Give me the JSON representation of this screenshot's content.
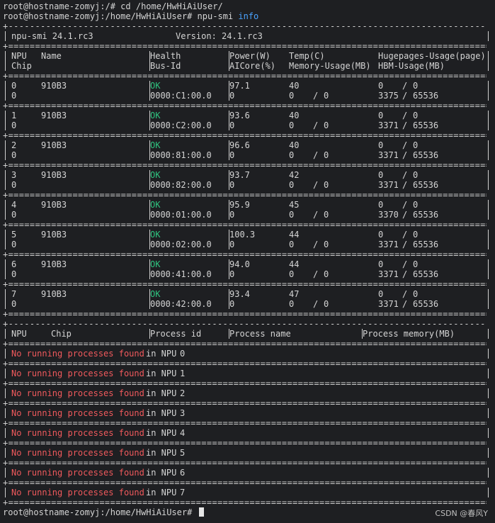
{
  "terminal": {
    "prompt1": "root@hostname-zomyj:/# ",
    "cmd1": "cd /home/HwHiAiUser/",
    "prompt2": "root@hostname-zomyj:/home/HwHiAiUser# ",
    "cmd2_base": "npu-smi ",
    "cmd2_keyword": "info",
    "prompt3": "root@hostname-zomyj:/home/HwHiAiUser# "
  },
  "smi": {
    "title_left": "npu-smi 24.1.rc3",
    "title_version": "Version: 24.1.rc3",
    "headers": {
      "npu": "NPU",
      "name": "Name",
      "health": "Health",
      "power": "Power(W)",
      "temp": "Temp(C)",
      "hugepages": "Hugepages-Usage(page)",
      "chip": "Chip",
      "busid": "Bus-Id",
      "aicore": "AICore(%)",
      "memory": "Memory-Usage(MB)",
      "hbm": "HBM-Usage(MB)"
    },
    "npus": [
      {
        "npu": "0",
        "name": "910B3",
        "health": "OK",
        "power": "97.1",
        "temp": "40",
        "huge_used": "0",
        "huge_total": "0",
        "chip": "0",
        "busid": "0000:C1:00.0",
        "aicore": "0",
        "mem_used": "0",
        "mem_total": "0",
        "hbm_used": "3375",
        "hbm_total": "65536"
      },
      {
        "npu": "1",
        "name": "910B3",
        "health": "OK",
        "power": "93.6",
        "temp": "40",
        "huge_used": "0",
        "huge_total": "0",
        "chip": "0",
        "busid": "0000:C2:00.0",
        "aicore": "0",
        "mem_used": "0",
        "mem_total": "0",
        "hbm_used": "3371",
        "hbm_total": "65536"
      },
      {
        "npu": "2",
        "name": "910B3",
        "health": "OK",
        "power": "96.6",
        "temp": "40",
        "huge_used": "0",
        "huge_total": "0",
        "chip": "0",
        "busid": "0000:81:00.0",
        "aicore": "0",
        "mem_used": "0",
        "mem_total": "0",
        "hbm_used": "3371",
        "hbm_total": "65536"
      },
      {
        "npu": "3",
        "name": "910B3",
        "health": "OK",
        "power": "93.7",
        "temp": "42",
        "huge_used": "0",
        "huge_total": "0",
        "chip": "0",
        "busid": "0000:82:00.0",
        "aicore": "0",
        "mem_used": "0",
        "mem_total": "0",
        "hbm_used": "3371",
        "hbm_total": "65536"
      },
      {
        "npu": "4",
        "name": "910B3",
        "health": "OK",
        "power": "95.9",
        "temp": "45",
        "huge_used": "0",
        "huge_total": "0",
        "chip": "0",
        "busid": "0000:01:00.0",
        "aicore": "0",
        "mem_used": "0",
        "mem_total": "0",
        "hbm_used": "3370",
        "hbm_total": "65536"
      },
      {
        "npu": "5",
        "name": "910B3",
        "health": "OK",
        "power": "100.3",
        "temp": "44",
        "huge_used": "0",
        "huge_total": "0",
        "chip": "0",
        "busid": "0000:02:00.0",
        "aicore": "0",
        "mem_used": "0",
        "mem_total": "0",
        "hbm_used": "3371",
        "hbm_total": "65536"
      },
      {
        "npu": "6",
        "name": "910B3",
        "health": "OK",
        "power": "94.0",
        "temp": "44",
        "huge_used": "0",
        "huge_total": "0",
        "chip": "0",
        "busid": "0000:41:00.0",
        "aicore": "0",
        "mem_used": "0",
        "mem_total": "0",
        "hbm_used": "3371",
        "hbm_total": "65536"
      },
      {
        "npu": "7",
        "name": "910B3",
        "health": "OK",
        "power": "93.4",
        "temp": "47",
        "huge_used": "0",
        "huge_total": "0",
        "chip": "0",
        "busid": "0000:42:00.0",
        "aicore": "0",
        "mem_used": "0",
        "mem_total": "0",
        "hbm_used": "3371",
        "hbm_total": "65536"
      }
    ],
    "proc_headers": {
      "npu": "NPU",
      "chip": "Chip",
      "pid": "Process id",
      "pname": "Process name",
      "pmem": "Process memory(MB)"
    },
    "no_proc_text": "No running processes found",
    "in_npu_text": "in NPU",
    "proc_npus": [
      "0",
      "1",
      "2",
      "3",
      "4",
      "5",
      "6",
      "7"
    ]
  },
  "watermark": "CSDN @春风Y",
  "colors": {
    "background": "#1e1f22",
    "ok": "#2ec27e",
    "error": "#f0595c",
    "keyword": "#4aa3ff"
  }
}
